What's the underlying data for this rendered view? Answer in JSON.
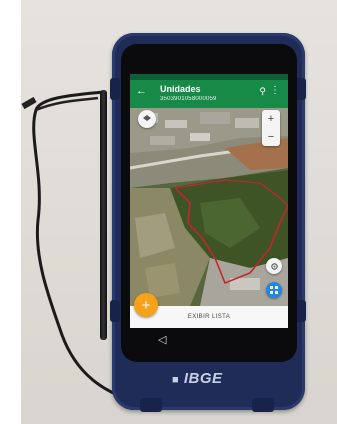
{
  "app": {
    "title": "Unidades",
    "code": "3503901058000059",
    "list_button": "EXIBIR LISTA"
  },
  "icons": {
    "back": "arrow-left-icon",
    "search": "search-icon",
    "menu": "more-vert-icon",
    "layers": "layers-icon",
    "zoom_in": "plus-icon",
    "zoom_out": "minus-icon",
    "locate": "gps-icon",
    "grid": "grid-icon",
    "add": "plus-icon"
  },
  "logo_text": "IBGE",
  "colors": {
    "appbar": "#178a48",
    "case": "#1f2c57",
    "fab_orange": "#f6a11a",
    "fab_blue": "#1e88e5",
    "boundary": "#c0272d"
  }
}
